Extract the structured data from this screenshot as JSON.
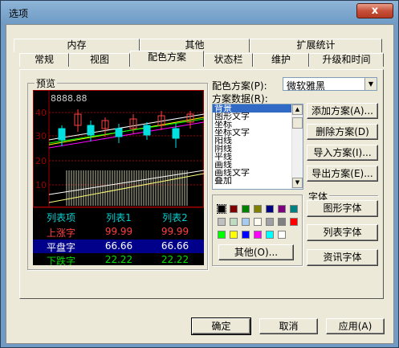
{
  "window": {
    "title": "选项",
    "close_label": "x"
  },
  "tabs_row1": [
    "内存",
    "其他",
    "扩展统计"
  ],
  "tabs_row2": [
    "常规",
    "视图",
    "配色方案",
    "状态栏",
    "维护",
    "升级和时间"
  ],
  "active_tab": "配色方案",
  "preview": {
    "label": "预览",
    "price_label": "8888.88",
    "axis_ticks": [
      "40",
      "30",
      "20",
      "10"
    ],
    "table_header": [
      "列表项",
      "列表1",
      "列表2"
    ],
    "rows": [
      {
        "label": "上涨字",
        "v1": "99.99",
        "v2": "99.99"
      },
      {
        "label": "平盘字",
        "v1": "66.66",
        "v2": "66.66"
      },
      {
        "label": "下跌字",
        "v1": "22.22",
        "v2": "22.22"
      }
    ],
    "colors": {
      "header_text": "#00d0d0",
      "up_text": "#ff4040",
      "flat_text": "#ffffff",
      "flat_bg": "#00008b",
      "down_text": "#00e000",
      "grid_red": "#a00000",
      "candle_up": "#ff4040",
      "candle_down": "#00e0e0"
    }
  },
  "scheme": {
    "scheme_label": "配色方案(P):",
    "scheme_value": "微软雅黑",
    "data_label": "方案数据(R):",
    "data_items": [
      "背景",
      "图形文字",
      "坐标",
      "坐标文字",
      "阳线",
      "阴线",
      "平线",
      "画线",
      "画线文字",
      "叠加"
    ],
    "selected_item": "背景"
  },
  "buttons": {
    "add": "添加方案(A)...",
    "delete": "删除方案(D)",
    "import": "导入方案(I)...",
    "export": "导出方案(E)...",
    "font_group": "字体",
    "graphic_font": "图形字体",
    "list_font": "列表字体",
    "info_font": "资讯字体",
    "other_colors": "其他(O)...",
    "ok": "确定",
    "cancel": "取消",
    "apply": "应用(A)"
  },
  "palette": [
    "#000000",
    "#800000",
    "#008000",
    "#808000",
    "#000080",
    "#800080",
    "#008080",
    "#c0c0c0",
    "#c0dcc0",
    "#a6caf0",
    "#fffbf0",
    "#a0a0a4",
    "#808080",
    "#ff0000",
    "#00ff00",
    "#ffff00",
    "#0000ff",
    "#ff00ff",
    "#00ffff",
    "#ffffff"
  ]
}
